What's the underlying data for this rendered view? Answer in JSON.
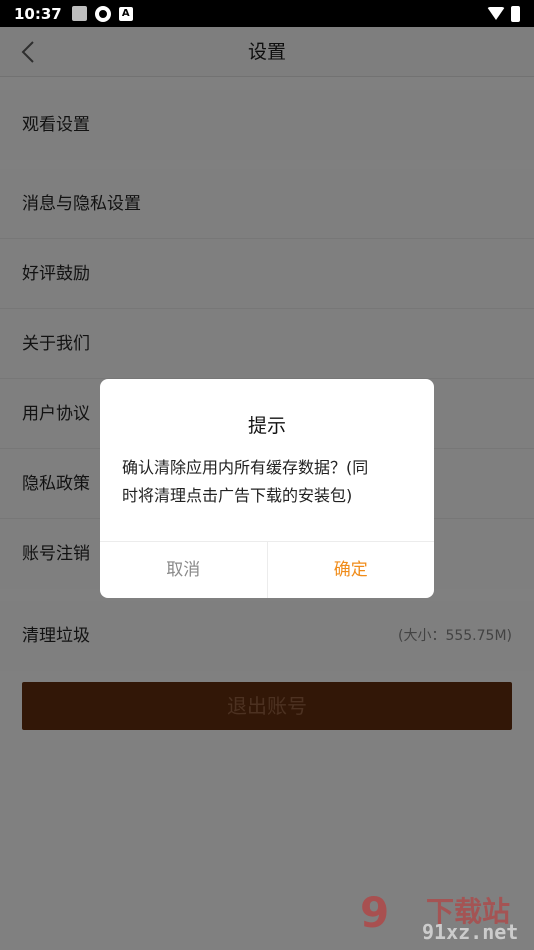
{
  "status_bar": {
    "time": "10:37",
    "icons": [
      "square-icon",
      "gear-icon",
      "a-icon",
      "wifi-icon",
      "battery-icon"
    ]
  },
  "nav": {
    "title": "设置",
    "back_icon": "chevron-left-icon"
  },
  "settings": {
    "watch": "观看设置",
    "items": [
      "消息与隐私设置",
      "好评鼓励",
      "关于我们",
      "用户协议",
      "隐私政策",
      "账号注销"
    ],
    "clear_cache": "清理垃圾",
    "cache_size": "(大小：555.75M)"
  },
  "logout_label": "退出账号",
  "dialog": {
    "title": "提示",
    "message_line1": "确认清除应用内所有缓存数据？(同",
    "message_line2": "时将清理点击广告下载的安装包)",
    "cancel_label": "取消",
    "ok_label": "确定"
  },
  "watermark": {
    "logo": "9",
    "top": "下载站",
    "bottom": "91xz.net"
  },
  "colors": {
    "accent": "#f08c1a",
    "logout_bg": "#5c2b0e"
  }
}
